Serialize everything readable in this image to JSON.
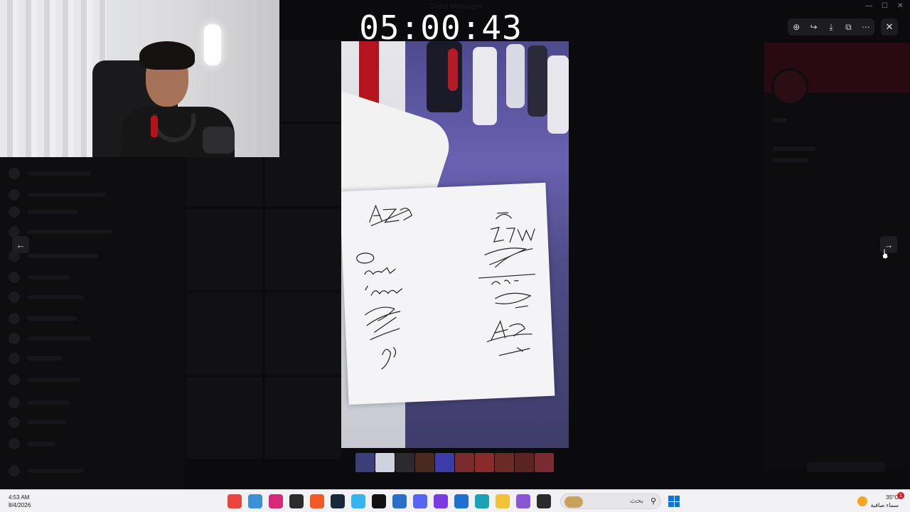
{
  "timer": "05:00:43",
  "viewer": {
    "title": "Direct Messages",
    "toolbar": [
      {
        "name": "zoom-in-icon",
        "glyph": "⊕"
      },
      {
        "name": "forward-icon",
        "glyph": "↪"
      },
      {
        "name": "download-icon",
        "glyph": "⤓"
      },
      {
        "name": "open-external-icon",
        "glyph": "⧉"
      },
      {
        "name": "more-icon",
        "glyph": "⋯"
      }
    ],
    "close_glyph": "✕",
    "prev_glyph": "←",
    "next_glyph": "→",
    "window_controls": {
      "minimize": "—",
      "maximize": "☐",
      "close": "✕"
    }
  },
  "photo": {
    "board_signatures_left": [
      "Azoz",
      "Saleh",
      "imazen"
    ],
    "board_signatures_right": [
      "S27w",
      "OSP",
      "A5"
    ]
  },
  "thumbnails": [
    "#3a3f7a",
    "#cfd3df",
    "#2b2b2d",
    "#4a2a20",
    "#3c3ca8",
    "#7a2a2a",
    "#8a2a2a",
    "#6a2a24",
    "#5a2424",
    "#7a2a30"
  ],
  "taskbar": {
    "time": "4:53 AM",
    "date": "8/4/2026",
    "search_placeholder": "بحث",
    "weather_temp": "35°C",
    "weather_desc": "سماء صافية",
    "notification_count": "1",
    "apps": [
      {
        "name": "chrome-icon",
        "color": "#e8453c"
      },
      {
        "name": "app-installer-icon",
        "color": "#3d8fd6"
      },
      {
        "name": "instagram-icon",
        "color": "#d6297a"
      },
      {
        "name": "obs-icon",
        "color": "#2b2b2b"
      },
      {
        "name": "brave-icon",
        "color": "#f05a24"
      },
      {
        "name": "steam-icon",
        "color": "#1b2838"
      },
      {
        "name": "streamlabs-icon",
        "color": "#36b4f0"
      },
      {
        "name": "capcut-icon",
        "color": "#111111"
      },
      {
        "name": "app-blue-icon",
        "color": "#2a6fc9"
      },
      {
        "name": "discord-icon",
        "color": "#5865f2"
      },
      {
        "name": "kick-icon",
        "color": "#7a3be0"
      },
      {
        "name": "store-icon",
        "color": "#1f6fd1"
      },
      {
        "name": "edge-icon",
        "color": "#1aa3b5"
      },
      {
        "name": "file-explorer-icon",
        "color": "#f2c23a"
      },
      {
        "name": "app-colorful-icon",
        "color": "#8a56d8"
      },
      {
        "name": "terminal-icon",
        "color": "#2b2b2b"
      }
    ]
  }
}
